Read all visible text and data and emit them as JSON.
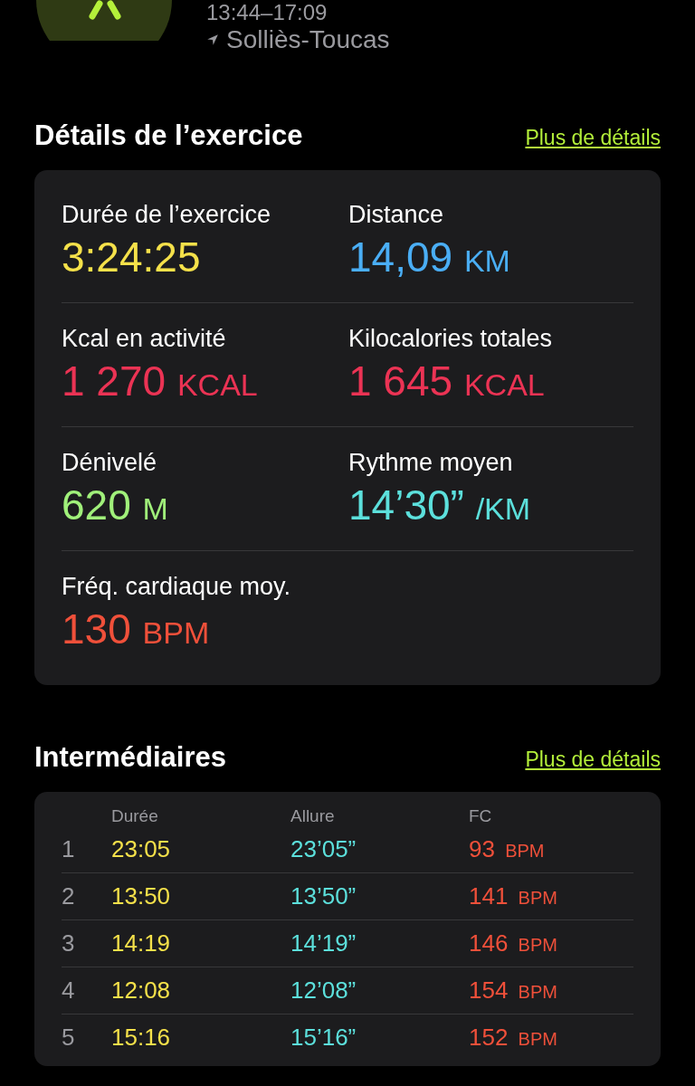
{
  "header": {
    "time": "13:44–17:09",
    "location": "Solliès-Toucas"
  },
  "details": {
    "title": "Détails de l’exercice",
    "link": "Plus de détails",
    "metrics": [
      {
        "label": "Durée de l’exercice",
        "value": "3:24:25",
        "color": "#f5e14a"
      },
      {
        "label": "Distance",
        "value": "14,09",
        "unit": "KM",
        "color": "#4aaef5"
      },
      {
        "label": "Kcal en activité",
        "value": "1 270",
        "unit": "KCAL",
        "color": "#eb3354"
      },
      {
        "label": "Kilocalories totales",
        "value": "1 645",
        "unit": "KCAL",
        "color": "#eb3354"
      },
      {
        "label": "Dénivelé",
        "value": "620",
        "unit": "M",
        "color": "#a0f07a"
      },
      {
        "label": "Rythme moyen",
        "value": "14’30”",
        "unit": "/KM",
        "color": "#5ce0dc"
      },
      {
        "label": "Fréq. cardiaque moy.",
        "value": "130",
        "unit": "BPM",
        "color": "#f0503a"
      }
    ]
  },
  "splits": {
    "title": "Intermédiaires",
    "link": "Plus de détails",
    "columns": [
      "Durée",
      "Allure",
      "FC"
    ],
    "rows": [
      {
        "index": "1",
        "duration": "23:05",
        "pace": "23’05”",
        "hr": "93",
        "unit": "BPM"
      },
      {
        "index": "2",
        "duration": "13:50",
        "pace": "13’50”",
        "hr": "141",
        "unit": "BPM"
      },
      {
        "index": "3",
        "duration": "14:19",
        "pace": "14’19”",
        "hr": "146",
        "unit": "BPM"
      },
      {
        "index": "4",
        "duration": "12:08",
        "pace": "12’08”",
        "hr": "154",
        "unit": "BPM"
      },
      {
        "index": "5",
        "duration": "15:16",
        "pace": "15’16”",
        "hr": "152",
        "unit": "BPM"
      }
    ]
  }
}
